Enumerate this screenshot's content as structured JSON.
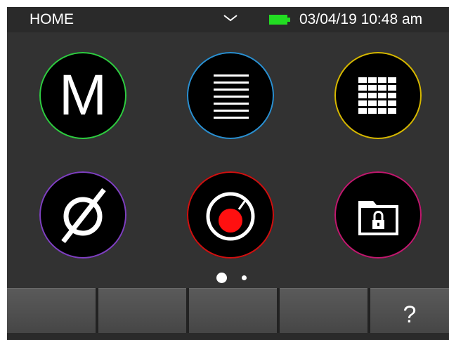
{
  "statusbar": {
    "title": "HOME",
    "datetime": "03/04/19 10:48 am",
    "battery_color": "#22dd22",
    "dropdown_icon": "chevron-down-icon"
  },
  "apps": [
    {
      "name": "meter-app",
      "icon": "m-letter-icon",
      "ring_color": "#2ecc40",
      "glyph": "M"
    },
    {
      "name": "list-app",
      "icon": "list-lines-icon",
      "ring_color": "#2a8fd0"
    },
    {
      "name": "grid-app",
      "icon": "grid-icon",
      "ring_color": "#d6b800"
    },
    {
      "name": "null-app",
      "icon": "empty-set-icon",
      "ring_color": "#7e3fc0"
    },
    {
      "name": "record-app",
      "icon": "record-dial-icon",
      "ring_color": "#d01010"
    },
    {
      "name": "lock-folder-app",
      "icon": "locked-folder-icon",
      "ring_color": "#c0186e"
    }
  ],
  "pager": {
    "pages": 2,
    "current": 1
  },
  "softkeys": [
    {
      "label": ""
    },
    {
      "label": ""
    },
    {
      "label": ""
    },
    {
      "label": ""
    },
    {
      "label": "?"
    }
  ]
}
